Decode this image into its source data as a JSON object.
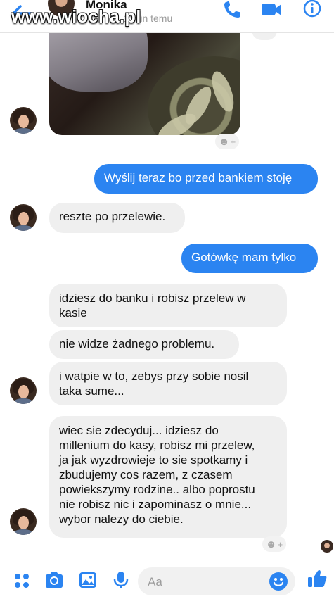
{
  "watermark": "www.wiocha.pl",
  "header": {
    "contact_name": "Monika",
    "status": "1 min temu",
    "icons": {
      "back": "back-arrow-icon",
      "call": "phone-icon",
      "video": "video-camera-icon",
      "info": "info-icon"
    }
  },
  "colors": {
    "accent": "#2b84f1",
    "incoming_bubble": "#efefef",
    "outgoing_text": "#ffffff"
  },
  "reactions": {
    "symbol": "+"
  },
  "messages": [
    {
      "dir": "in",
      "type": "photo"
    },
    {
      "dir": "out",
      "text": "Wyślij teraz bo przed bankiem stoję"
    },
    {
      "dir": "in",
      "text": "reszte po przelewie."
    },
    {
      "dir": "out",
      "text": "Gotówkę mam tylko"
    },
    {
      "dir": "in",
      "lines": [
        "idziesz do banku i robisz przelew w",
        "kasie"
      ]
    },
    {
      "dir": "in",
      "text": "nie widze żadnego problemu."
    },
    {
      "dir": "in",
      "lines": [
        "i watpie w to, zebys przy sobie nosil",
        "taka sume..."
      ]
    },
    {
      "dir": "in",
      "lines": [
        "wiec sie zdecyduj... idziesz do",
        "millenium do kasy, robisz mi przelew,",
        "ja jak wyzdrowieje to sie spotkamy i",
        "zbudujemy cos razem, z czasem",
        "powiekszymy rodzine.. albo poprostu",
        "nie robisz nic i zapominasz o mnie...",
        "wybor nalezy do ciebie."
      ]
    }
  ],
  "composer": {
    "placeholder": "Aa",
    "icons": {
      "more": "four-dots-icon",
      "camera": "camera-icon",
      "gallery": "image-icon",
      "mic": "microphone-icon",
      "emoji": "emoji-icon",
      "like": "thumbs-up-icon"
    }
  }
}
